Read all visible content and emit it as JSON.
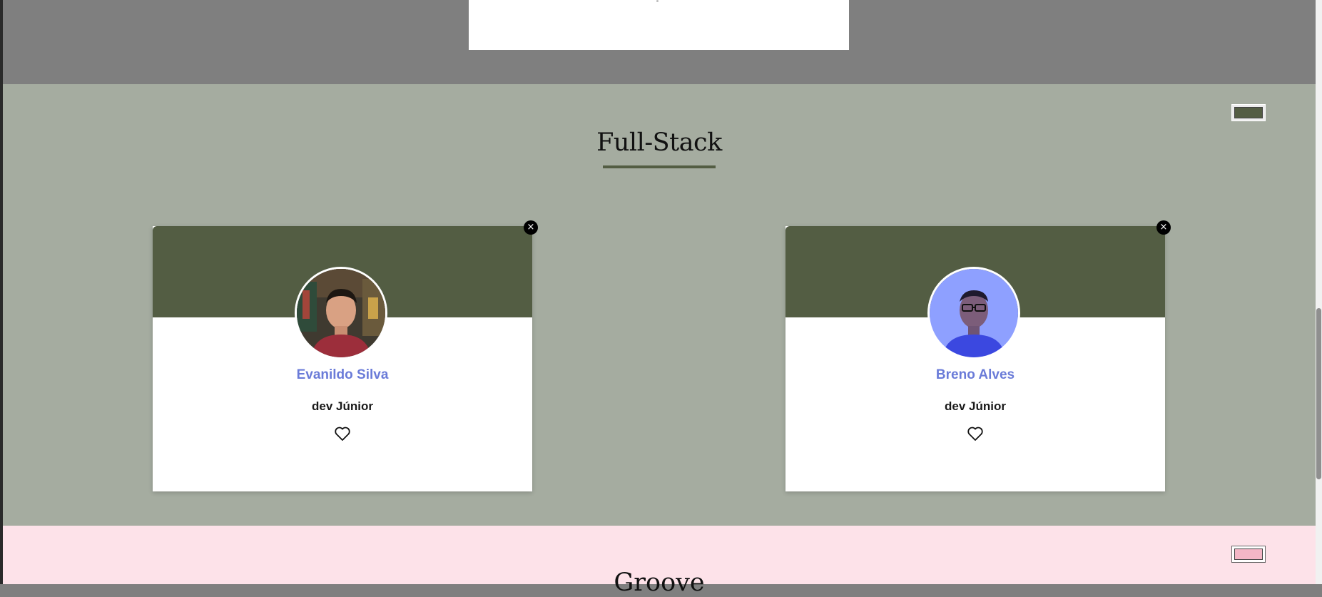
{
  "sections": {
    "fullstack": {
      "title": "Full-Stack",
      "bg_color": "#a5aca0",
      "accent_color": "#535d43",
      "color_picker_value": "#535d43"
    },
    "groovy": {
      "title": "Groove",
      "bg_color": "#fde2e9",
      "color_picker_value": "#f4b6c6"
    }
  },
  "cards": [
    {
      "name": "Evanildo Silva",
      "role": "dev Júnior",
      "close_icon": "×",
      "avatar": "avatar-photo",
      "like_icon": "heart-outline-icon"
    },
    {
      "name": "Breno Alves",
      "role": "dev Júnior",
      "close_icon": "×",
      "avatar": "avatar-photo",
      "like_icon": "heart-outline-icon"
    }
  ],
  "colors": {
    "name_color": "#6a7bd8",
    "card_header": "#535d43",
    "top_section": "#7f7f7f"
  }
}
